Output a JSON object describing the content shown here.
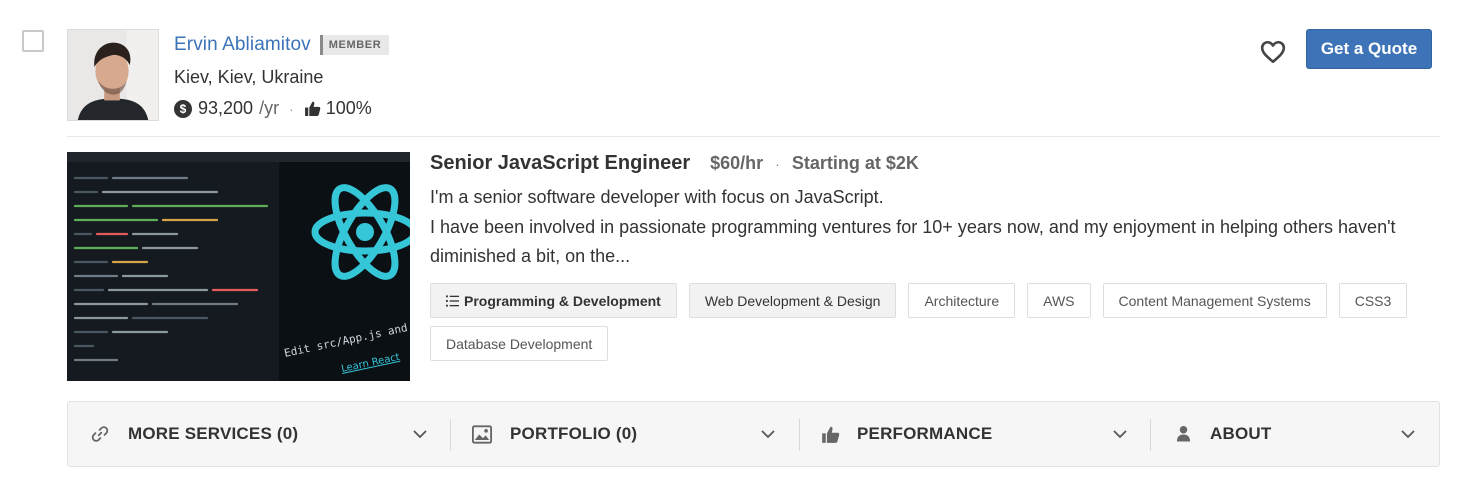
{
  "profile": {
    "name": "Ervin Abliamitov",
    "badge": "MEMBER",
    "location": "Kiev, Kiev, Ukraine",
    "rate": "93,200",
    "rate_unit": "/yr",
    "rating": "100%",
    "quote_label": "Get a Quote"
  },
  "service": {
    "title": "Senior JavaScript Engineer",
    "hourly": "$60/hr",
    "separator": "·",
    "starting": "Starting at $2K",
    "description_line1": "I'm a senior software developer with focus on JavaScript.",
    "description_line2": "I have been involved in passionate programming ventures for 10+ years now, and my enjoyment in helping others haven't diminished a bit, on the...",
    "tags": [
      "Programming & Development",
      "Web Development & Design",
      "Architecture",
      "AWS",
      "Content Management Systems",
      "CSS3",
      "Database Development"
    ],
    "image_caption_1": "Edit src/App.js and save to r",
    "image_caption_2": "Learn React"
  },
  "footer": {
    "items": [
      {
        "label": "MORE SERVICES (0)",
        "icon": "link-icon"
      },
      {
        "label": "PORTFOLIO (0)",
        "icon": "image-icon"
      },
      {
        "label": "PERFORMANCE",
        "icon": "thumbs-up-icon"
      },
      {
        "label": "ABOUT",
        "icon": "user-icon"
      }
    ]
  },
  "colors": {
    "link": "#3b73b9",
    "button": "#3e74b7",
    "react": "#35c6d8"
  }
}
